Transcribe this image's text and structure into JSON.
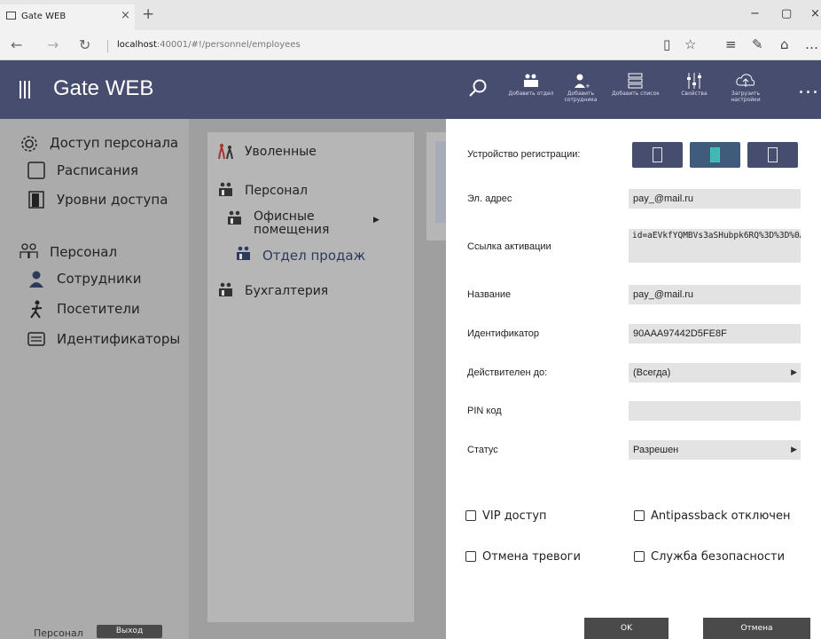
{
  "browser": {
    "tab_title": "Gate WEB",
    "tab_close": "×",
    "new_tab": "+",
    "win_min": "−",
    "win_max": "▢",
    "win_close": "×",
    "url_host": "localhost",
    "url_rest": ":40001/#!/personnel/employees"
  },
  "app": {
    "title": "Gate WEB",
    "toolbar": [
      {
        "label": "Добавить отдел",
        "icon": "add-department-icon"
      },
      {
        "label": "Добавить сотрудника",
        "icon": "add-employee-icon"
      },
      {
        "label": "Добавить список",
        "icon": "add-list-icon"
      },
      {
        "label": "Свойства",
        "icon": "properties-icon"
      },
      {
        "label": "Загрузить настройки",
        "icon": "upload-settings-icon"
      }
    ],
    "more": "..."
  },
  "sidebar": {
    "items": [
      {
        "label": "Доступ персонала",
        "icon": "gear-icon"
      },
      {
        "label": "Расписания",
        "icon": "calendar-icon"
      },
      {
        "label": "Уровни доступа",
        "icon": "door-icon"
      },
      {
        "label": "Персонал",
        "icon": "people-icon"
      },
      {
        "label": "Сотрудники",
        "icon": "employee-icon"
      },
      {
        "label": "Посетители",
        "icon": "visitor-icon"
      },
      {
        "label": "Идентификаторы",
        "icon": "card-reader-icon"
      }
    ],
    "footer_label": "Персонал",
    "exit_label": "Выход"
  },
  "tree": {
    "items": [
      {
        "label": "Уволенные",
        "icon": "fired-icon"
      },
      {
        "label": "Персонал",
        "icon": "group-icon"
      },
      {
        "label": "Офисные помещения",
        "icon": "group-icon"
      },
      {
        "label": "Отдел продаж",
        "icon": "group-icon"
      },
      {
        "label": "Бухгалтерия",
        "icon": "group-icon"
      }
    ]
  },
  "dialog": {
    "device_label": "Устройство регистрации:",
    "email_label": "Эл. адрес",
    "email_value": "pay_@mail.ru",
    "activation_label": "Ссылка активации",
    "activation_value": "id=aEVkfYQMBVs3aSHubpk6RQ%3D%3D%0A",
    "name_label": "Название",
    "name_value": "pay_@mail.ru",
    "id_label": "Идентификатор",
    "id_value": "90AAA97442D5FE8F",
    "valid_label": "Действителен до:",
    "valid_value": "(Всегда)",
    "pin_label": "PIN код",
    "pin_value": "",
    "status_label": "Статус",
    "status_value": "Разрешен",
    "checkboxes": [
      {
        "label": "VIP доступ",
        "checked": false
      },
      {
        "label": "Antipassback отключен",
        "checked": false
      },
      {
        "label": "Отмена тревоги",
        "checked": false
      },
      {
        "label": "Служба безопасности",
        "checked": false
      }
    ],
    "ok_label": "OK",
    "cancel_label": "Отмена"
  },
  "colors": {
    "header": "#474d6f",
    "sidebar": "#ababab",
    "button_dark": "#4a4a4a",
    "device_active": "#3fb8b8"
  }
}
